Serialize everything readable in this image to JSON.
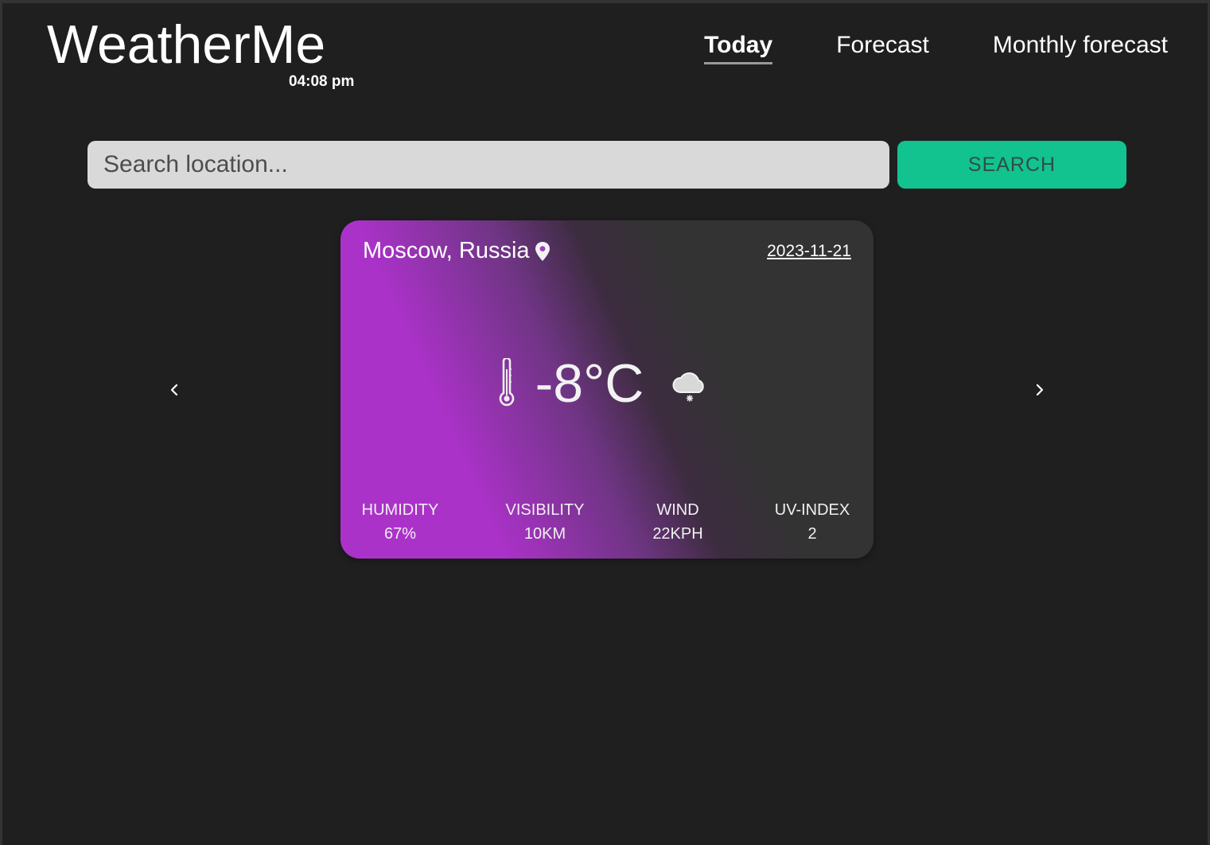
{
  "app": {
    "title": "WeatherMe",
    "time": "04:08 pm"
  },
  "nav": {
    "items": [
      {
        "label": "Today",
        "active": true
      },
      {
        "label": "Forecast",
        "active": false
      },
      {
        "label": "Monthly forecast",
        "active": false
      }
    ]
  },
  "search": {
    "placeholder": "Search location...",
    "value": "",
    "button_label": "SEARCH"
  },
  "card": {
    "location": "Moscow, Russia",
    "date": "2023-11-21",
    "temperature": "-8°C",
    "condition_icon": "snow-cloud-icon",
    "stats": [
      {
        "label": "HUMIDITY",
        "value": "67%"
      },
      {
        "label": "VISIBILITY",
        "value": "10KM"
      },
      {
        "label": "WIND",
        "value": "22KPH"
      },
      {
        "label": "UV-INDEX",
        "value": "2"
      }
    ]
  },
  "icons": {
    "location": "map-pin-icon",
    "temperature": "thermometer-icon",
    "prev": "chevron-left-icon",
    "next": "chevron-right-icon"
  },
  "colors": {
    "background": "#1f1f1f",
    "accent": "#12c28f",
    "card_purple": "#ab32c9",
    "card_dark": "#333333",
    "search_field": "#d9d9d9"
  }
}
